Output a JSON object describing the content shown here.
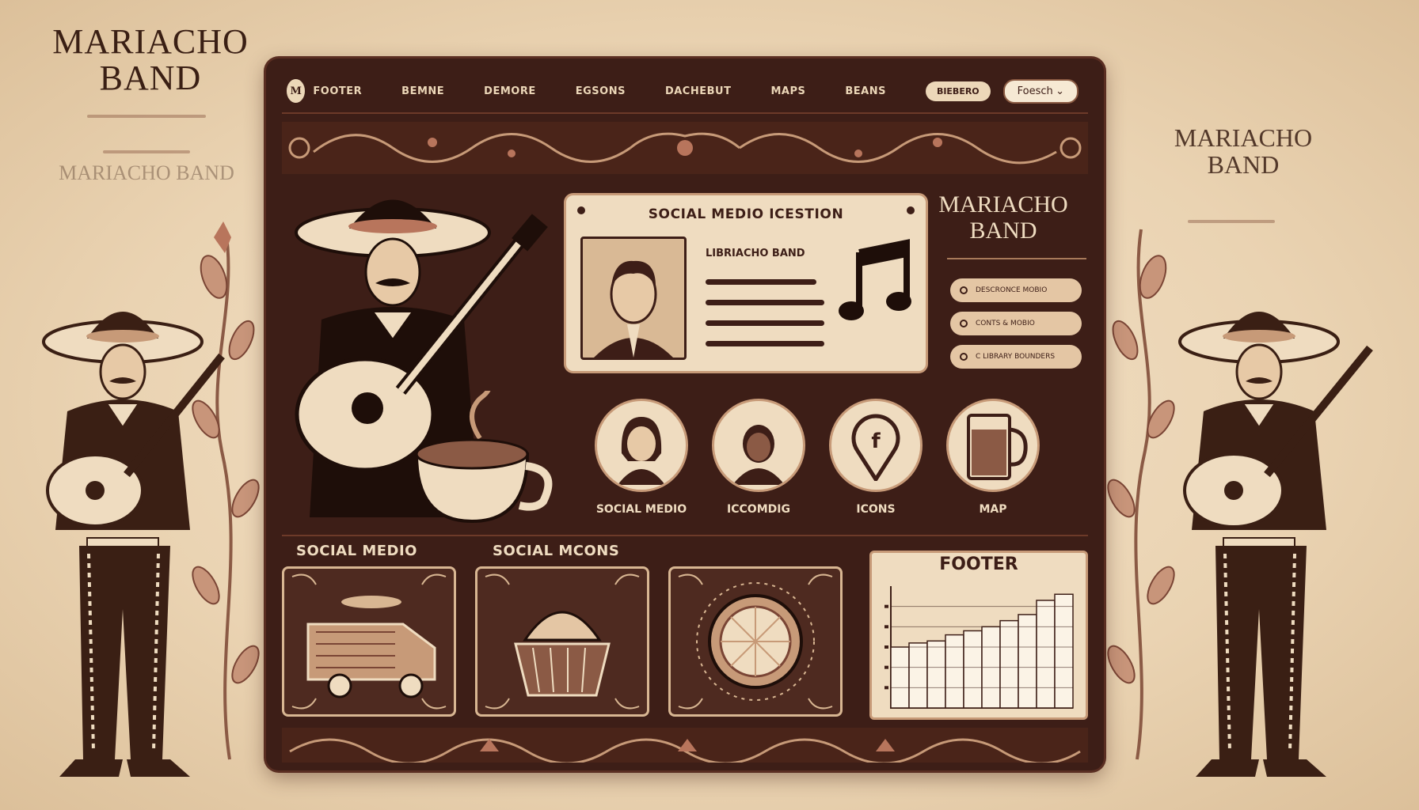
{
  "brand": {
    "left_title": "MARIACHO BAND",
    "left_ghost": "MARIACHO BAND",
    "right_title": "MARIACHO BAND"
  },
  "nav": {
    "logo": "M",
    "items": [
      "FOOTER",
      "BEMNE",
      "DEMORE",
      "EGSONS",
      "DACHEBUT",
      "MAPS",
      "BEANS"
    ],
    "pill": "BIEBERO",
    "search_value": "Foesch",
    "search_icon_glyph": "⌄"
  },
  "profile": {
    "heading": "SOCIAL MEDIO ICESTION",
    "name": "LIBRIACHO BAND"
  },
  "panel_brand": "MARIACHO BAND",
  "side_buttons": [
    "DESCRONCE MOBIO",
    "CONTS & MOBIO",
    "C LIBRARY BOUNDERS"
  ],
  "circle_items": [
    {
      "label": "SOCIAL MEDIO",
      "icon": "woman-avatar-icon"
    },
    {
      "label": "ICCOMDIG",
      "icon": "man-avatar-icon"
    },
    {
      "label": "ICONS",
      "icon": "facebook-pin-icon"
    },
    {
      "label": "MAP",
      "icon": "mug-icon"
    }
  ],
  "bottom": {
    "title_1": "SOCIAL MEDIO",
    "title_2": "SOCIAL MCONS",
    "footer_title": "FOOTER"
  },
  "chart_data": {
    "type": "area",
    "title": "FOOTER",
    "x": [
      1,
      2,
      3,
      4,
      5,
      6,
      7,
      8,
      9,
      10
    ],
    "values": [
      3,
      3.2,
      3.3,
      3.6,
      3.8,
      4.0,
      4.3,
      4.6,
      5.3,
      5.6
    ],
    "ylim": [
      0,
      6
    ],
    "grid": true
  },
  "colors": {
    "panel": "#3d1e17",
    "cream": "#efdcc0",
    "accent": "#c79a78",
    "background": "#ead3b2"
  }
}
